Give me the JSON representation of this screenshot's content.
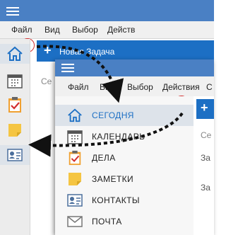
{
  "menu": {
    "file": "Файл",
    "view": "Вид",
    "select": "Выбор",
    "actions_back": "Действ",
    "actions_front": "Действия",
    "trailing": "С"
  },
  "back_toolbar": {
    "plus": "+",
    "new_task": "Новая Задача"
  },
  "nav": {
    "today": "СЕГОДНЯ",
    "calendar": "КАЛЕНДАРЬ",
    "tasks": "ДЕЛА",
    "notes": "ЗАМЕТКИ",
    "contacts": "КОНТАКТЫ",
    "mail": "ПОЧТА"
  },
  "front_right": {
    "t1": "Се",
    "t2": "За",
    "t3": "За"
  },
  "back_right": {
    "t1": "Се",
    "t2": "За"
  },
  "chevrons": {
    "expand": "›",
    "collapse": "‹"
  },
  "colors": {
    "accent": "#1c6fc4",
    "highlight": "#d32f2f",
    "titlebar": "#4a80c4"
  }
}
